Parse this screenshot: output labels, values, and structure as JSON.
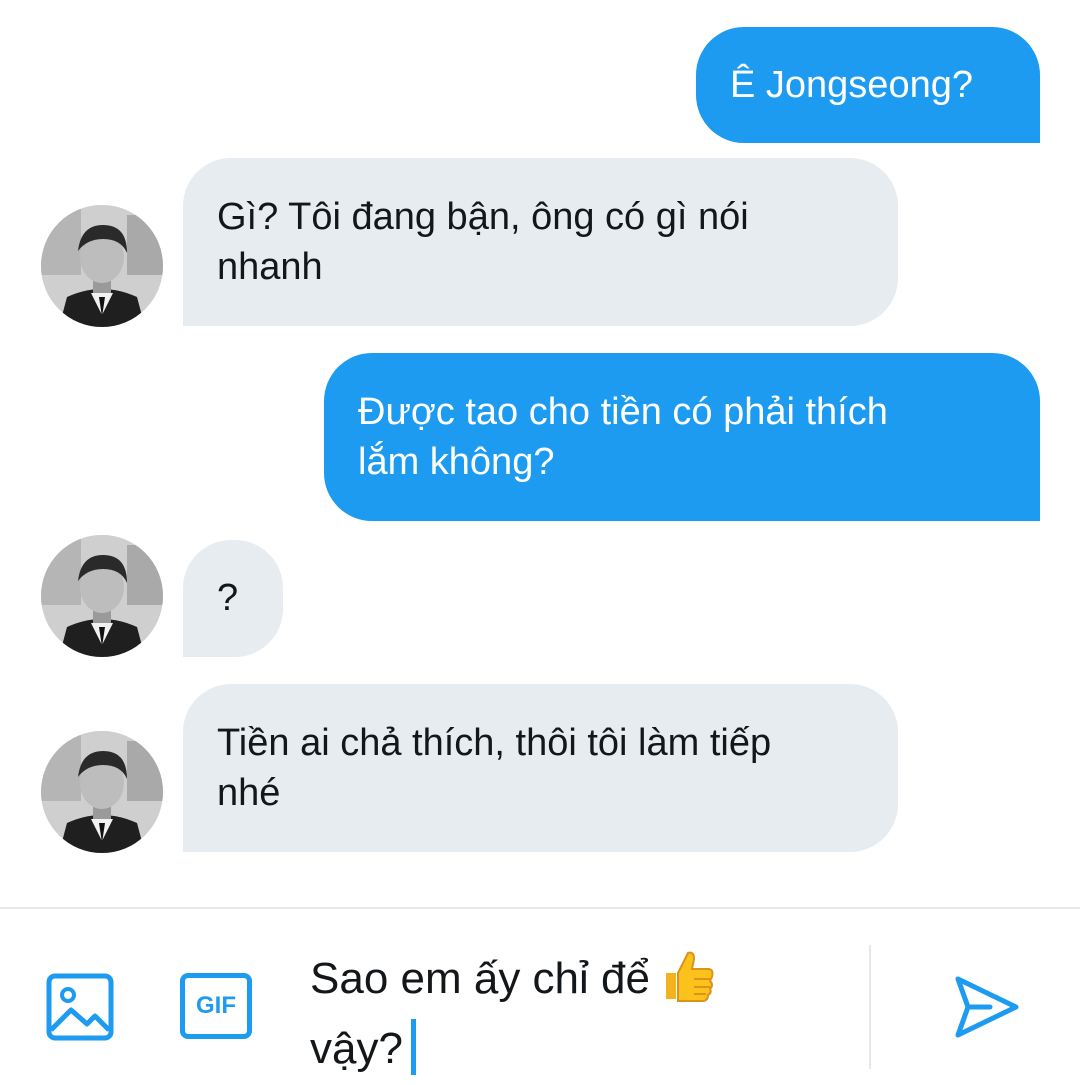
{
  "messages": [
    {
      "id": "m1",
      "direction": "outgoing",
      "text": "Ê Jongseong?"
    },
    {
      "id": "m2",
      "direction": "incoming",
      "lines": [
        "Gì? Tôi đang bận, ông có gì nói",
        "nhanh"
      ]
    },
    {
      "id": "m3",
      "direction": "outgoing",
      "lines": [
        "Được tao cho tiền có phải thích",
        "lắm không?"
      ]
    },
    {
      "id": "m4",
      "direction": "incoming",
      "text": "?"
    },
    {
      "id": "m5",
      "direction": "incoming",
      "lines": [
        "Tiền ai chả thích, thôi tôi làm tiếp",
        "nhé"
      ]
    }
  ],
  "composer": {
    "draft_line1": "Sao em ấy chỉ để",
    "draft_emoji": "thumbs-up-emoji",
    "draft_line2": "vậy?",
    "gif_label": "GIF",
    "media_icon": "image-icon",
    "send_icon": "send-icon"
  },
  "colors": {
    "accent": "#1d9bf0",
    "incoming_bubble": "#e7ecf0",
    "text": "#14171a"
  }
}
